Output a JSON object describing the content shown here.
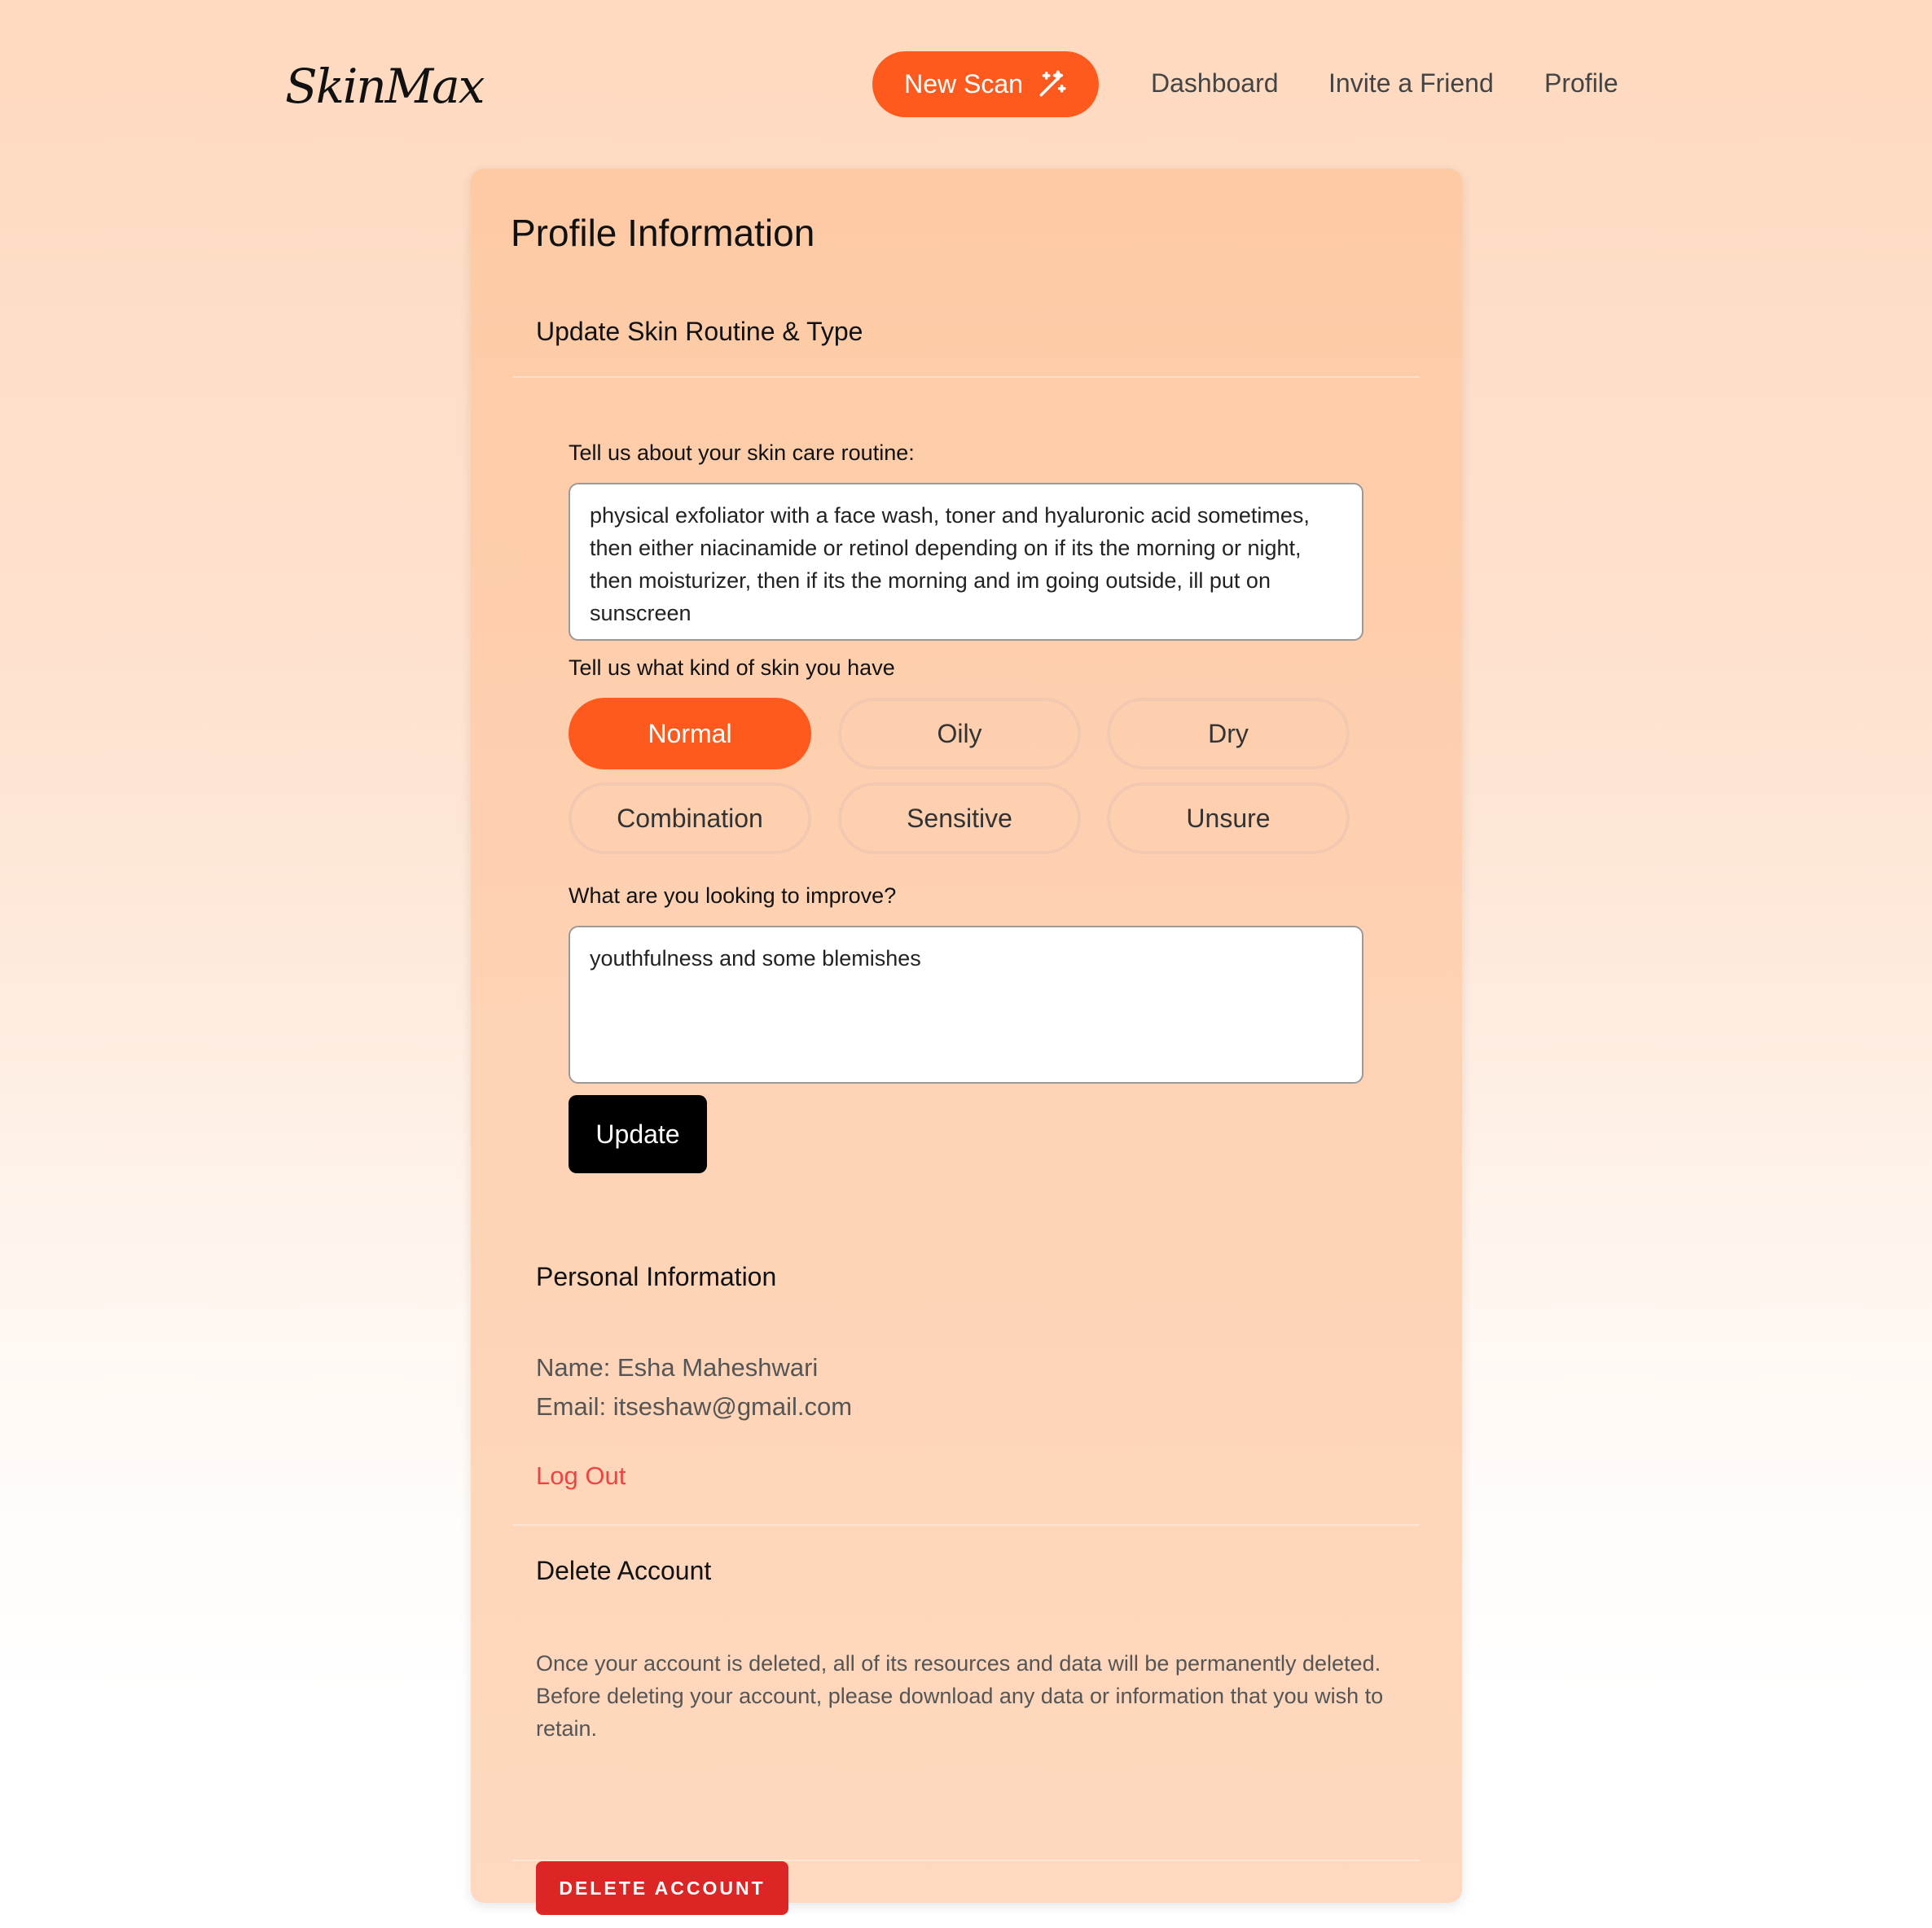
{
  "header": {
    "logo": "SkinMax",
    "new_scan_label": "New Scan",
    "new_scan_icon": "magic-wand-icon",
    "nav_items": [
      "Dashboard",
      "Invite a Friend",
      "Profile"
    ]
  },
  "profile": {
    "title": "Profile Information",
    "skin_section": {
      "title": "Update Skin Routine & Type",
      "routine_label": "Tell us about your skin care routine:",
      "routine_value": "physical exfoliator with a face wash, toner and hyaluronic acid sometimes, then either niacinamide or retinol depending on if its the morning or night, then moisturizer, then if its the morning and im going outside, ill put on sunscreen",
      "skin_type_label": "Tell us what kind of skin you have",
      "skin_types": [
        "Normal",
        "Oily",
        "Dry",
        "Combination",
        "Sensitive",
        "Unsure"
      ],
      "selected_skin_type": "Normal",
      "improve_label": "What are you looking to improve?",
      "improve_value": "youthfulness and some blemishes",
      "update_label": "Update"
    },
    "personal_section": {
      "title": "Personal Information",
      "name_line": "Name: Esha Maheshwari",
      "email_line": "Email: itseshaw@gmail.com",
      "logout_label": "Log Out"
    },
    "delete_section": {
      "title": "Delete Account",
      "description": "Once your account is deleted, all of its resources and data will be permanently deleted. Before deleting your account, please download any data or information that you wish to retain.",
      "button_label": "DELETE ACCOUNT"
    }
  },
  "colors": {
    "accent": "#fe5a1d",
    "danger": "#dc2626",
    "logout": "#ef4444"
  }
}
